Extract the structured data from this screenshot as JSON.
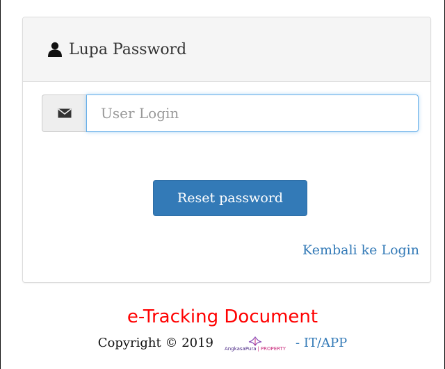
{
  "panel": {
    "title": "Lupa Password",
    "icon": "user-icon"
  },
  "form": {
    "user_placeholder": "User Login",
    "user_value": "",
    "input_icon": "envelope-icon",
    "reset_label": "Reset password",
    "back_link": "Kembali ke Login"
  },
  "footer": {
    "title": "e-Tracking Document",
    "copyright": "Copyright © 2019",
    "logo": {
      "brand": "AngkasaPura",
      "separator": "|",
      "property": "PROPERTY"
    },
    "suffix": "- IT/APP"
  },
  "colors": {
    "primary": "#337ab7",
    "footer_title": "#ff0000",
    "heading_bg": "#f5f5f5"
  }
}
